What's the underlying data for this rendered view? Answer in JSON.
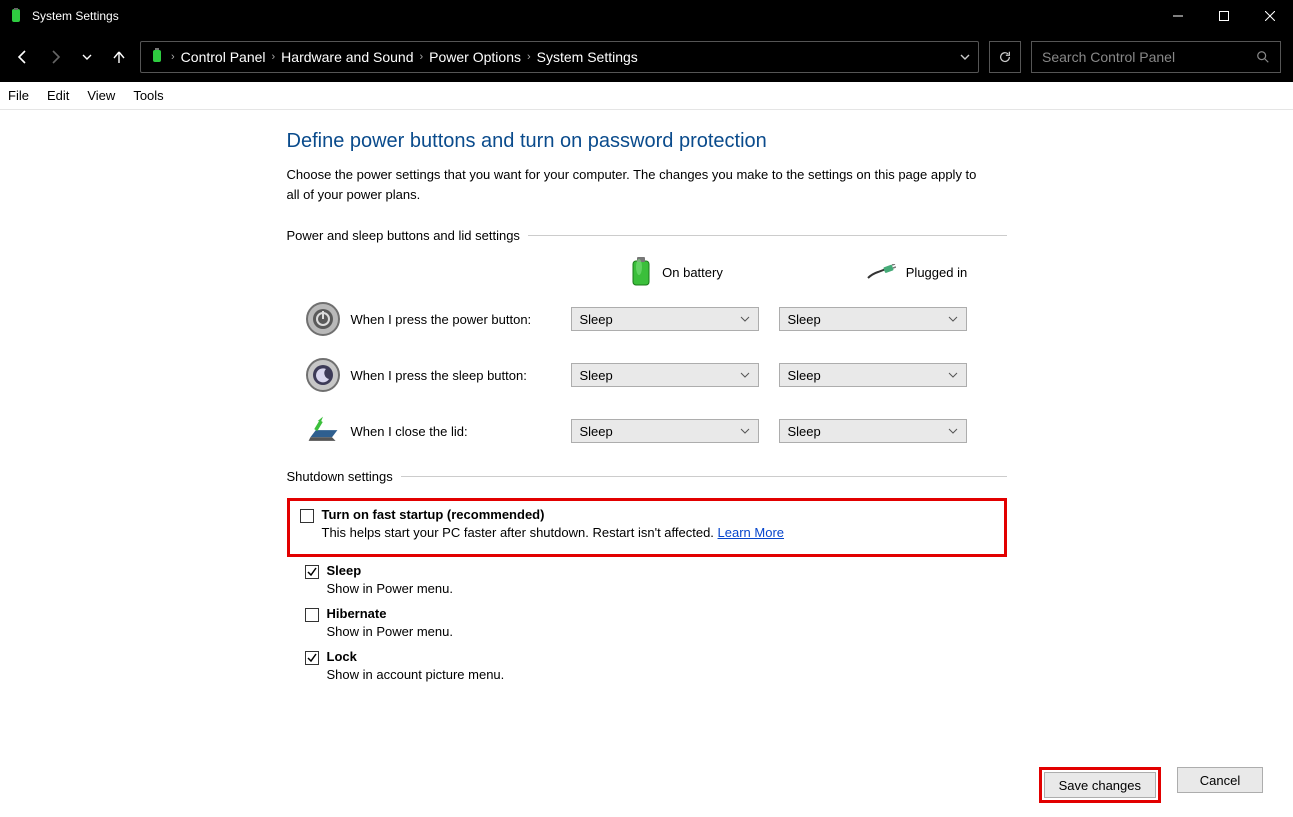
{
  "window": {
    "title": "System Settings"
  },
  "breadcrumbs": [
    "Control Panel",
    "Hardware and Sound",
    "Power Options",
    "System Settings"
  ],
  "search": {
    "placeholder": "Search Control Panel"
  },
  "menus": [
    "File",
    "Edit",
    "View",
    "Tools"
  ],
  "page": {
    "title": "Define power buttons and turn on password protection",
    "desc": "Choose the power settings that you want for your computer. The changes you make to the settings on this page apply to all of your power plans."
  },
  "section_buttons": "Power and sleep buttons and lid settings",
  "cols": {
    "battery": "On battery",
    "plugged": "Plugged in"
  },
  "rows": {
    "power": {
      "label": "When I press the power button:",
      "battery": "Sleep",
      "plugged": "Sleep"
    },
    "sleep": {
      "label": "When I press the sleep button:",
      "battery": "Sleep",
      "plugged": "Sleep"
    },
    "lid": {
      "label": "When I close the lid:",
      "battery": "Sleep",
      "plugged": "Sleep"
    }
  },
  "section_shutdown": "Shutdown settings",
  "shutdown": {
    "fast": {
      "label": "Turn on fast startup (recommended)",
      "desc": "This helps start your PC faster after shutdown. Restart isn't affected. ",
      "link": "Learn More",
      "checked": false
    },
    "sleep_opt": {
      "label": "Sleep",
      "desc": "Show in Power menu.",
      "checked": true
    },
    "hibernate": {
      "label": "Hibernate",
      "desc": "Show in Power menu.",
      "checked": false
    },
    "lock": {
      "label": "Lock",
      "desc": "Show in account picture menu.",
      "checked": true
    }
  },
  "buttons": {
    "save": "Save changes",
    "cancel": "Cancel"
  }
}
